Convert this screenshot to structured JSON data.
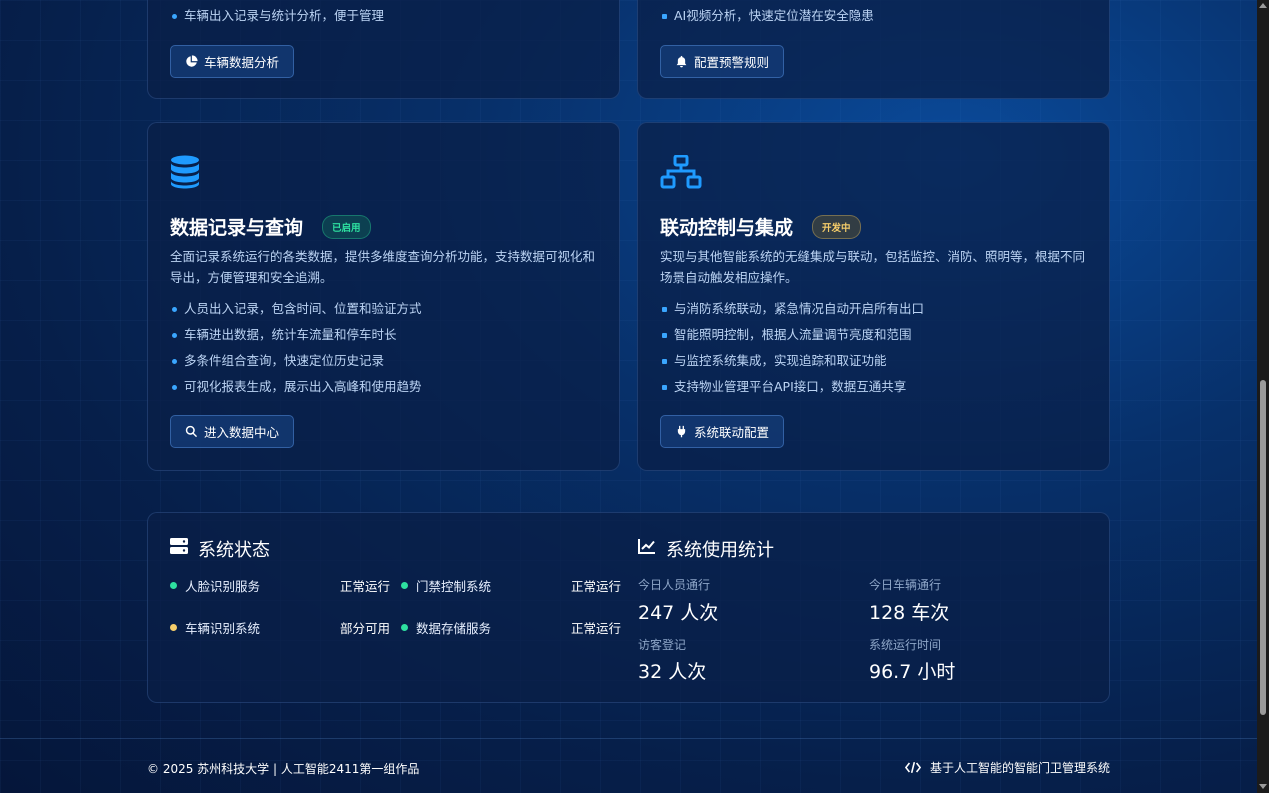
{
  "top_cards": [
    {
      "bullet": "车辆出入记录与统计分析，便于管理",
      "button": "车辆数据分析",
      "button_icon": "pie-chart-icon"
    },
    {
      "bullet": "AI视频分析，快速定位潜在安全隐患",
      "button": "配置预警规则",
      "button_icon": "bell-icon"
    }
  ],
  "feature_cards": [
    {
      "icon": "database-icon",
      "title": "数据记录与查询",
      "badge": "已启用",
      "badge_color": "#2ee0a0",
      "description": "全面记录系统运行的各类数据，提供多维度查询分析功能，支持数据可视化和导出，方便管理和安全追溯。",
      "bullets": [
        "人员出入记录，包含时间、位置和验证方式",
        "车辆进出数据，统计车流量和停车时长",
        "多条件组合查询，快速定位历史记录",
        "可视化报表生成，展示出入高峰和使用趋势"
      ],
      "button": "进入数据中心",
      "button_icon": "search-icon"
    },
    {
      "icon": "network-icon",
      "title": "联动控制与集成",
      "badge": "开发中",
      "badge_color": "#f5cd6a",
      "description": "实现与其他智能系统的无缝集成与联动，包括监控、消防、照明等，根据不同场景自动触发相应操作。",
      "bullets": [
        "与消防系统联动，紧急情况自动开启所有出口",
        "智能照明控制，根据人流量调节亮度和范围",
        "与监控系统集成，实现追踪和取证功能",
        "支持物业管理平台API接口，数据互通共享"
      ],
      "button": "系统联动配置",
      "button_icon": "plug-icon"
    }
  ],
  "status_panel": {
    "title": "系统状态",
    "items": [
      {
        "name": "人脸识别服务",
        "status": "正常运行",
        "color": "#2ee0a0"
      },
      {
        "name": "门禁控制系统",
        "status": "正常运行",
        "color": "#2ee0a0"
      },
      {
        "name": "车辆识别系统",
        "status": "部分可用",
        "color": "#f5cd6a"
      },
      {
        "name": "数据存储服务",
        "status": "正常运行",
        "color": "#2ee0a0"
      }
    ]
  },
  "stats_panel": {
    "title": "系统使用统计",
    "items": [
      {
        "label": "今日人员通行",
        "value": "247 人次"
      },
      {
        "label": "今日车辆通行",
        "value": "128 车次"
      },
      {
        "label": "访客登记",
        "value": "32 人次"
      },
      {
        "label": "系统运行时间",
        "value": "96.7 小时"
      }
    ]
  },
  "footer": {
    "copyright": "© 2025 苏州科技大学 | 人工智能2411第一组作品",
    "tagline": "基于人工智能的智能门卫管理系统"
  },
  "colors": {
    "accent": "#3aa6ff",
    "ok": "#2ee0a0",
    "warn": "#f5cd6a"
  }
}
